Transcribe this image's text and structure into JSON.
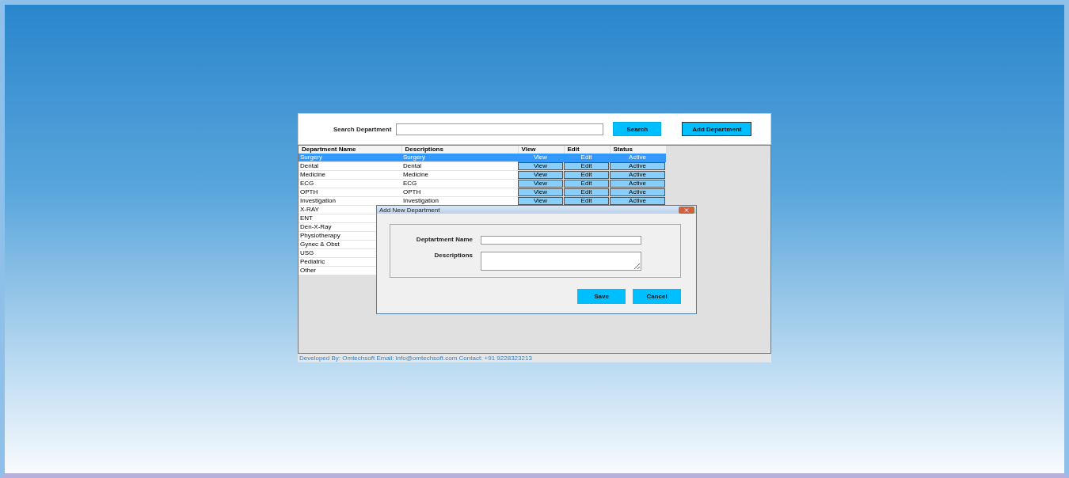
{
  "header": {
    "search_label": "Search Department",
    "search_button": "Search",
    "add_button": "Add Department"
  },
  "table": {
    "columns": [
      "Department Name",
      "Descriptions",
      "View",
      "Edit",
      "Status"
    ],
    "rows": [
      {
        "name": "Surgery",
        "description": "Surgery",
        "view": "View",
        "edit": "Edit",
        "status": "Active",
        "selected": true
      },
      {
        "name": "Dental",
        "description": "Dental",
        "view": "View",
        "edit": "Edit",
        "status": "Active",
        "selected": false
      },
      {
        "name": "Medicine",
        "description": "Medicine",
        "view": "View",
        "edit": "Edit",
        "status": "Active",
        "selected": false
      },
      {
        "name": "ECG",
        "description": "ECG",
        "view": "View",
        "edit": "Edit",
        "status": "Active",
        "selected": false
      },
      {
        "name": "OPTH",
        "description": "OPTH",
        "view": "View",
        "edit": "Edit",
        "status": "Active",
        "selected": false
      },
      {
        "name": "Investigation",
        "description": "Investigation",
        "view": "View",
        "edit": "Edit",
        "status": "Active",
        "selected": false
      },
      {
        "name": "X-RAY",
        "selected": false
      },
      {
        "name": "ENT",
        "selected": false
      },
      {
        "name": "Den-X-Ray",
        "selected": false
      },
      {
        "name": "Physiotherapy",
        "selected": false
      },
      {
        "name": "Gynec & Obst",
        "selected": false
      },
      {
        "name": "USG",
        "selected": false
      },
      {
        "name": "Pediatric",
        "selected": false
      },
      {
        "name": "Other",
        "selected": false
      }
    ]
  },
  "dialog": {
    "title": "Add New Department",
    "name_label": "Deptartment Name",
    "description_label": "Descriptions",
    "save_button": "Save",
    "cancel_button": "Cancel"
  },
  "footer": "Developed By: Omtechsoft Email: info@omtechsoft.com Contact: +91 9228323213"
}
